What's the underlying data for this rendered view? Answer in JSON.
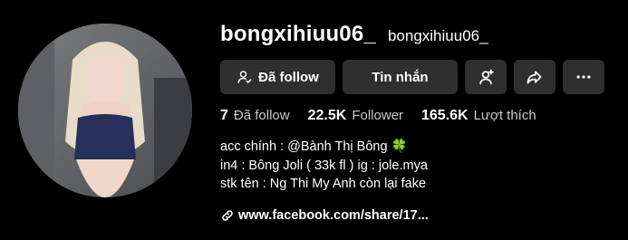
{
  "profile": {
    "unique_id": "bongxihiuu06_",
    "nickname": "bongxihiuu06_",
    "avatar_icon": "profile-avatar-photo"
  },
  "actions": {
    "follow_label": "Đã follow",
    "follow_icon": "user-check-icon",
    "message_label": "Tin nhắn",
    "add_friend_icon": "add-user-icon",
    "share_icon": "share-arrow-icon",
    "more_icon": "more-dots-icon"
  },
  "stats": [
    {
      "count": "7",
      "label": "Đã follow"
    },
    {
      "count": "22.5K",
      "label": "Follower"
    },
    {
      "count": "165.6K",
      "label": "Lượt thích"
    }
  ],
  "bio": {
    "line1_text": "acc chính : @Bành Thị Bông ",
    "line1_emoji": "🍀",
    "line2": "in4 : Bông Joli ( 33k fl ) ig : jole.mya",
    "line3": "stk tên : Ng Thi My Anh còn lại fake"
  },
  "link": {
    "icon": "link-chain-icon",
    "text": "www.facebook.com/share/17..."
  },
  "colors": {
    "background": "#000000",
    "button_bg": "#2f2f2f",
    "secondary_text": "#c8c8c8",
    "clover": "#3cc04a"
  }
}
